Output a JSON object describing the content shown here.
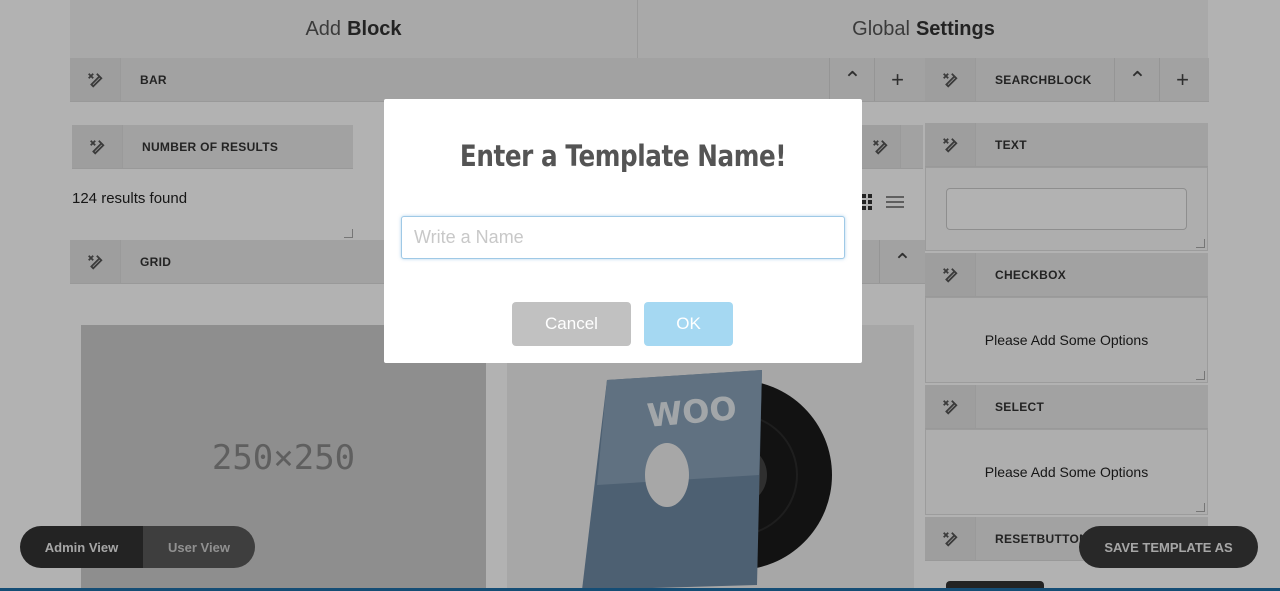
{
  "header": {
    "add_block_prefix": "Add",
    "add_block_bold": "Block",
    "global_prefix": "Global",
    "global_bold": "Settings"
  },
  "left": {
    "bar_label": "BAR",
    "number_of_results_label": "NUMBER OF RESULTS",
    "results_text": "124 results found",
    "grid_label": "GRID",
    "placeholder_image_text": "250×250",
    "vinyl_text": "WOO"
  },
  "right": {
    "searchblock_label": "SEARCHBLOCK",
    "text_label": "TEXT",
    "checkbox_label": "CHECKBOX",
    "checkbox_options": "Please Add Some Options",
    "select_label": "SELECT",
    "select_options": "Please Add Some Options",
    "resetbutton_label": "RESETBUTTON"
  },
  "footer": {
    "admin_view": "Admin View",
    "user_view": "User View",
    "save_template": "SAVE TEMPLATE AS"
  },
  "modal": {
    "title": "Enter a Template Name!",
    "input_placeholder": "Write a Name",
    "input_value": "",
    "cancel_label": "Cancel",
    "ok_label": "OK"
  },
  "colors": {
    "overlay": "rgba(0,0,0,0.30)",
    "ok_button": "#a5d8f2",
    "cancel_button": "#c1c1c1",
    "footer_pill": "#444444"
  }
}
